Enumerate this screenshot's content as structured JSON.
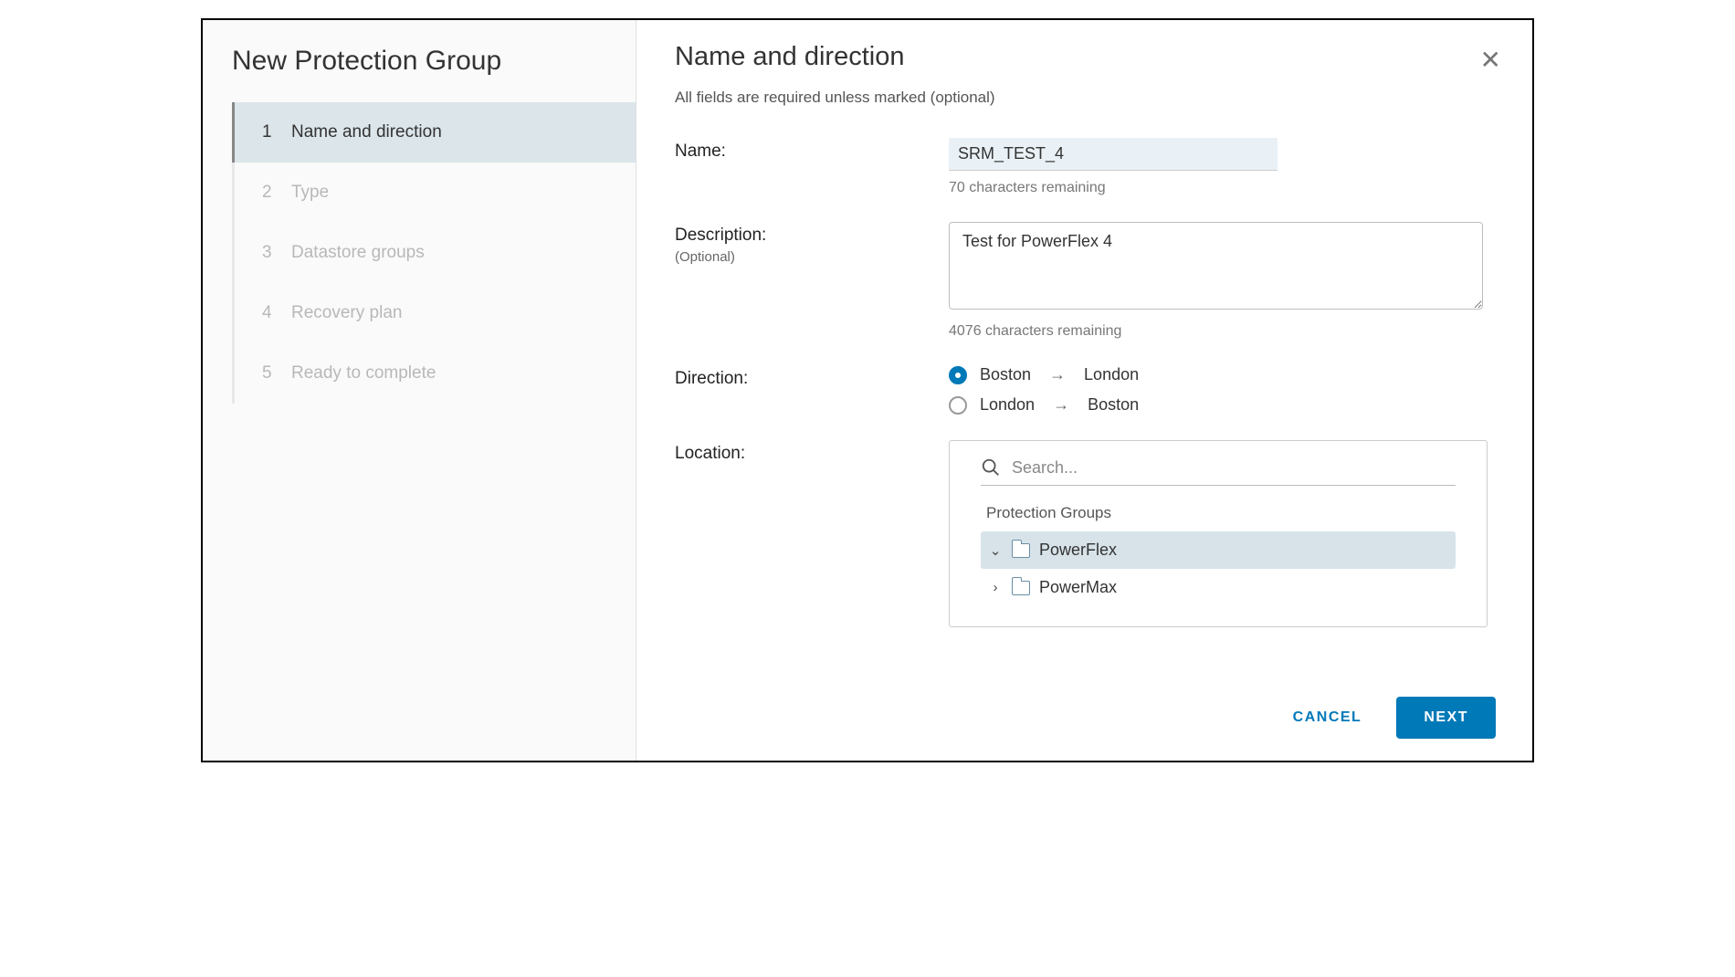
{
  "sidebar": {
    "title": "New Protection Group",
    "steps": [
      {
        "num": "1",
        "label": "Name and direction",
        "active": true
      },
      {
        "num": "2",
        "label": "Type",
        "active": false
      },
      {
        "num": "3",
        "label": "Datastore groups",
        "active": false
      },
      {
        "num": "4",
        "label": "Recovery plan",
        "active": false
      },
      {
        "num": "5",
        "label": "Ready to complete",
        "active": false
      }
    ]
  },
  "main": {
    "title": "Name and direction",
    "subtitle": "All fields are required unless marked (optional)",
    "name_label": "Name:",
    "name_value": "SRM_TEST_4",
    "name_hint": "70 characters remaining",
    "desc_label": "Description:",
    "desc_optional": "(Optional)",
    "desc_value": "Test for PowerFlex 4",
    "desc_hint": "4076 characters remaining",
    "direction_label": "Direction:",
    "direction_options": [
      {
        "from": "Boston",
        "to": "London",
        "selected": true
      },
      {
        "from": "London",
        "to": "Boston",
        "selected": false
      }
    ],
    "location_label": "Location:",
    "search_placeholder": "Search...",
    "tree_header": "Protection Groups",
    "tree_items": [
      {
        "label": "PowerFlex",
        "expanded": true,
        "selected": true
      },
      {
        "label": "PowerMax",
        "expanded": false,
        "selected": false
      }
    ]
  },
  "footer": {
    "cancel": "CANCEL",
    "next": "NEXT"
  }
}
